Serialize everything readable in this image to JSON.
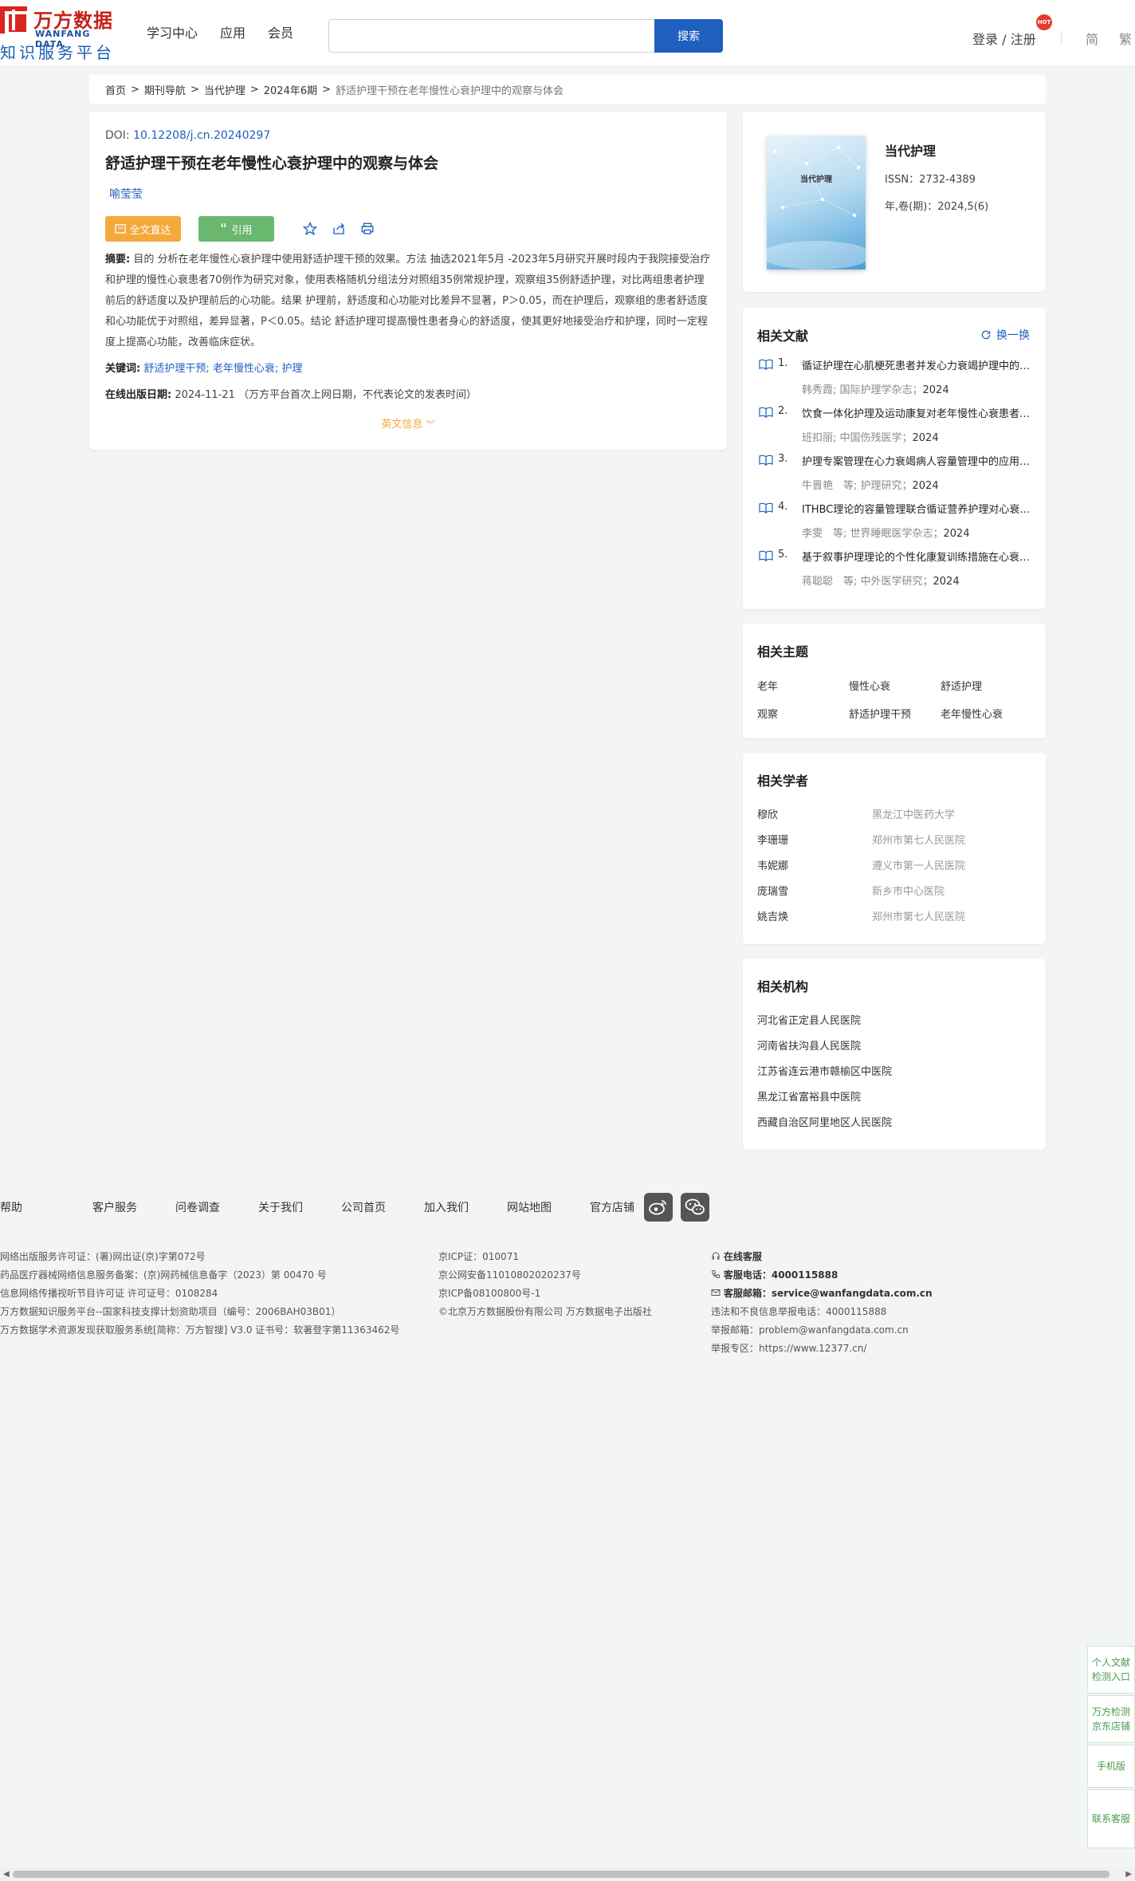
{
  "header": {
    "logo_cn": "万方数据",
    "logo_en": "WANFANG DATA",
    "logo_sub": "知识服务平台",
    "nav": [
      "学习中心",
      "应用",
      "会员"
    ],
    "search_placeholder": "",
    "search_button": "搜索",
    "login": "登录 / 注册",
    "hot": "HOT",
    "lang_simplified": "简",
    "lang_traditional": "繁"
  },
  "breadcrumb": {
    "items": [
      "首页",
      "期刊导航",
      "当代护理",
      "2024年6期"
    ],
    "sep": ">",
    "current": "舒适护理干预在老年慢性心衰护理中的观察与体会"
  },
  "article": {
    "doi_label": "DOI:",
    "doi": "10.12208/j.cn.20240297",
    "title": "舒适护理干预在老年慢性心衰护理中的观察与体会",
    "author": "喻莹莹",
    "btn_full": "全文直达",
    "btn_cite": "引用",
    "abstract_label": "摘要:",
    "abstract": "目的 分析在老年慢性心衰护理中使用舒适护理干预的效果。方法 抽选2021年5月 -2023年5月研究开展时段内于我院接受治疗和护理的慢性心衰患者70例作为研究对象，使用表格随机分组法分对照组35例常规护理，观察组35例舒适护理，对比两组患者护理前后的舒适度以及护理前后的心功能。结果 护理前，舒适度和心功能对比差异不显著，P＞0.05，而在护理后，观察组的患者舒适度和心功能优于对照组，差异显著，P＜0.05。结论 舒适护理可提高慢性患者身心的舒适度，使其更好地接受治疗和护理，同时一定程度上提高心功能，改善临床症状。",
    "keywords_label": "关键词:",
    "keywords": [
      "舒适护理干预",
      "老年慢性心衰",
      "护理"
    ],
    "keyword_sep": ";",
    "pubdate_label": "在线出版日期:",
    "pubdate": "2024-11-21",
    "pubdate_note": "（万方平台首次上网日期，不代表论文的发表时间）",
    "en_info": "英文信息"
  },
  "journal": {
    "cover_title": "当代护理",
    "name": "当代护理",
    "issn": "ISSN：2732-4389",
    "volume": "年,卷(期)：2024,5(6)"
  },
  "related_refs": {
    "title": "相关文献",
    "switch": "换一换",
    "items": [
      {
        "num": "1.",
        "title": "循证护理在心肌梗死患者并发心力衰竭护理中的应用",
        "meta": "韩秀霞; 国际护理学杂志；",
        "year": "2024"
      },
      {
        "num": "2.",
        "title": "饮食一体化护理及运动康复对老年慢性心衰患者的影响",
        "meta": "班扣丽; 中国伤残医学；",
        "year": "2024"
      },
      {
        "num": "3.",
        "title": "护理专案管理在心力衰竭病人容量管理中的应用效果",
        "meta": "牛晋艳　等; 护理研究；",
        "year": "2024"
      },
      {
        "num": "4.",
        "title": "ITHBC理论的容量管理联合循证营养护理对心衰患者的影响",
        "meta": "李雯　等; 世界睡眠医学杂志；",
        "year": "2024"
      },
      {
        "num": "5.",
        "title": "基于叙事护理理论的个性化康复训练措施在心衰患者中的应用",
        "meta": "蒋聪聪　等; 中外医学研究；",
        "year": "2024"
      }
    ]
  },
  "related_topics": {
    "title": "相关主题",
    "items": [
      "老年",
      "慢性心衰",
      "舒适护理",
      "观察",
      "舒适护理干预",
      "老年慢性心衰"
    ]
  },
  "related_scholars": {
    "title": "相关学者",
    "items": [
      {
        "name": "穆欣",
        "affil": "黑龙江中医药大学"
      },
      {
        "name": "李珊珊",
        "affil": "郑州市第七人民医院"
      },
      {
        "name": "韦妮娜",
        "affil": "遵义市第一人民医院"
      },
      {
        "name": "庞瑞雪",
        "affil": "新乡市中心医院"
      },
      {
        "name": "姚吉焕",
        "affil": "郑州市第七人民医院"
      }
    ]
  },
  "related_orgs": {
    "title": "相关机构",
    "items": [
      "河北省正定县人民医院",
      "河南省扶沟县人民医院",
      "江苏省连云港市赣榆区中医院",
      "黑龙江省富裕县中医院",
      "西藏自治区阿里地区人民医院"
    ]
  },
  "footer": {
    "nav": [
      "帮助",
      "客户服务",
      "问卷调查",
      "关于我们",
      "公司首页",
      "加入我们",
      "网站地图",
      "官方店铺"
    ],
    "col1": [
      "网络出版服务许可证：(署)网出证(京)字第072号",
      "药品医疗器械网络信息服务备案：(京)网药械信息备字（2023）第 00470 号",
      "信息网络传播视听节目许可证 许可证号：0108284",
      "万方数据知识服务平台--国家科技支撑计划资助项目（编号：2006BAH03B01）",
      "万方数据学术资源发现获取服务系统[简称：万方智搜] V3.0 证书号：软著登字第11363462号"
    ],
    "col2": [
      "京ICP证：010071",
      "京公网安备11010802020237号",
      "京ICP备08100800号-1",
      "©北京万方数据股份有限公司 万方数据电子出版社"
    ],
    "online_service": "在线客服",
    "phone_label": "客服电话：",
    "phone": "4000115888",
    "email_label": "客服邮箱：",
    "email": "service@wanfangdata.com.cn",
    "report_phone": "违法和不良信息举报电话：4000115888",
    "report_email": "举报邮箱：problem@wanfangdata.com.cn",
    "report_site": "举报专区：https://www.12377.cn/"
  },
  "float": {
    "b1": "个人文献检测入口",
    "b2": "万方检测京东店铺",
    "b3": "手机版",
    "b4": "联系客服"
  }
}
